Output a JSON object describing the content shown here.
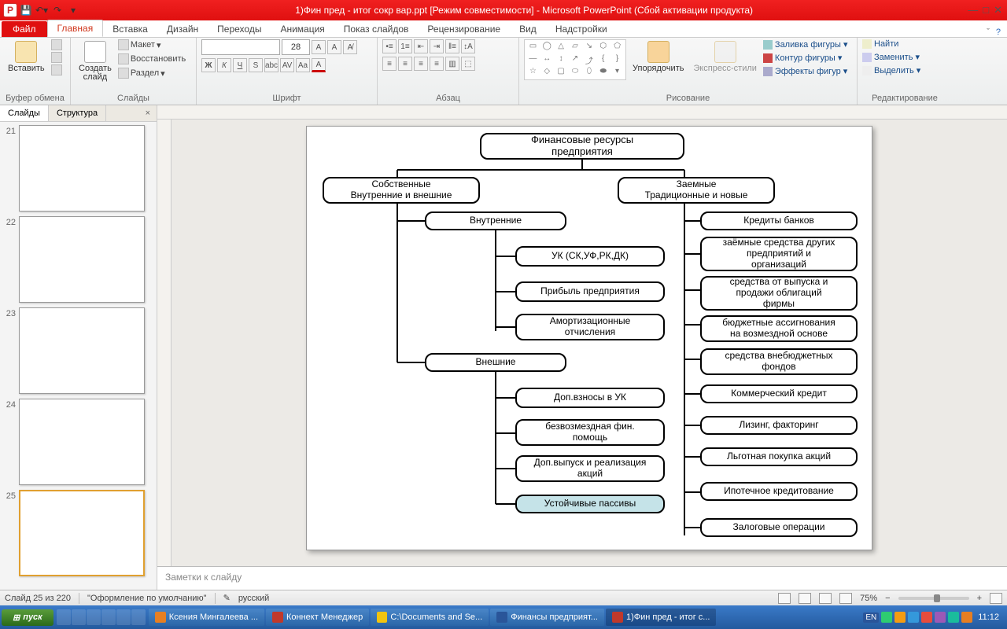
{
  "titlebar": {
    "title": "1)Фин пред - итог сокр вар.ppt [Режим совместимости]  -  Microsoft PowerPoint (Сбой активации продукта)"
  },
  "ribbon": {
    "file": "Файл",
    "tabs": [
      "Главная",
      "Вставка",
      "Дизайн",
      "Переходы",
      "Анимация",
      "Показ слайдов",
      "Рецензирование",
      "Вид",
      "Надстройки"
    ],
    "paste": "Вставить",
    "clipboard_group": "Буфер обмена",
    "newslide": "Создать\nслайд",
    "layout": "Макет",
    "reset": "Восстановить",
    "section": "Раздел",
    "slides_group": "Слайды",
    "font_size": "28",
    "font_group": "Шрифт",
    "paragraph_group": "Абзац",
    "arrange": "Упорядочить",
    "quickstyles": "Экспресс-стили",
    "shape_fill": "Заливка фигуры",
    "shape_outline": "Контур фигуры",
    "shape_effects": "Эффекты фигур",
    "drawing_group": "Рисование",
    "find": "Найти",
    "replace": "Заменить",
    "select": "Выделить",
    "editing_group": "Редактирование"
  },
  "left": {
    "tab_slides": "Слайды",
    "tab_outline": "Структура",
    "nums": [
      "21",
      "22",
      "23",
      "24",
      "25"
    ]
  },
  "notes": {
    "placeholder": "Заметки к слайду"
  },
  "status": {
    "slide": "Слайд 25 из 220",
    "theme": "\"Оформление по умолчанию\"",
    "lang": "русский",
    "zoom": "75%"
  },
  "taskbar": {
    "start": "пуск",
    "items": [
      "Ксения Мингалеева ...",
      "Коннект Менеджер",
      "C:\\Documents and Se...",
      "Финансы предприят...",
      "1)Фин пред - итог с..."
    ],
    "lang_ind": "EN",
    "clock": "11:12"
  },
  "chart_data": {
    "type": "tree",
    "title": "Финансовые ресурсы предприятия",
    "children": [
      {
        "label": "Собственные\nВнутренние и внешние",
        "children": [
          {
            "label": "Внутренние",
            "children": [
              {
                "label": "УК (СК,УФ,РК,ДК)"
              },
              {
                "label": "Прибыль предприятия"
              },
              {
                "label": "Амортизационные отчисления"
              }
            ]
          },
          {
            "label": "Внешние",
            "children": [
              {
                "label": "Доп.взносы в УК"
              },
              {
                "label": "безвозмездная фин. помощь"
              },
              {
                "label": "Доп.выпуск и реализация акций"
              },
              {
                "label": "Устойчивые пассивы",
                "highlight": true
              }
            ]
          }
        ]
      },
      {
        "label": "Заемные\nТрадиционные и новые",
        "children": [
          {
            "label": "Кредиты банков"
          },
          {
            "label": "заёмные средства других предприятий и организаций"
          },
          {
            "label": "средства от выпуска и продажи облигаций фирмы"
          },
          {
            "label": "бюджетные ассигнования на возмездной основе"
          },
          {
            "label": "средства внебюджетных фондов"
          },
          {
            "label": "Коммерческий кредит"
          },
          {
            "label": "Лизинг, факторинг"
          },
          {
            "label": "Льготная покупка акций"
          },
          {
            "label": "Ипотечное кредитование"
          },
          {
            "label": "Залоговые операции"
          }
        ]
      }
    ]
  },
  "nodes": {
    "root": "Финансовые ресурсы\nпредприятия",
    "own": "Собственные\nВнутренние и внешние",
    "loan": "Заемные\nТрадиционные и новые",
    "int": "Внутренние",
    "ext": "Внешние",
    "i1": "УК (СК,УФ,РК,ДК)",
    "i2": "Прибыль предприятия",
    "i3": "Амортизационные\nотчисления",
    "e1": "Доп.взносы в УК",
    "e2": "безвозмездная фин.\nпомощь",
    "e3": "Доп.выпуск и реализация\nакций",
    "e4": "Устойчивые пассивы",
    "l1": "Кредиты банков",
    "l2": "заёмные средства других\nпредприятий и\nорганизаций",
    "l3": "средства от выпуска и\nпродажи облигаций\nфирмы",
    "l4": "бюджетные ассигнования\nна возмездной основе",
    "l5": "средства внебюджетных\nфондов",
    "l6": "Коммерческий кредит",
    "l7": "Лизинг, факторинг",
    "l8": "Льготная покупка акций",
    "l9": "Ипотечное кредитование",
    "l10": "Залоговые операции"
  }
}
